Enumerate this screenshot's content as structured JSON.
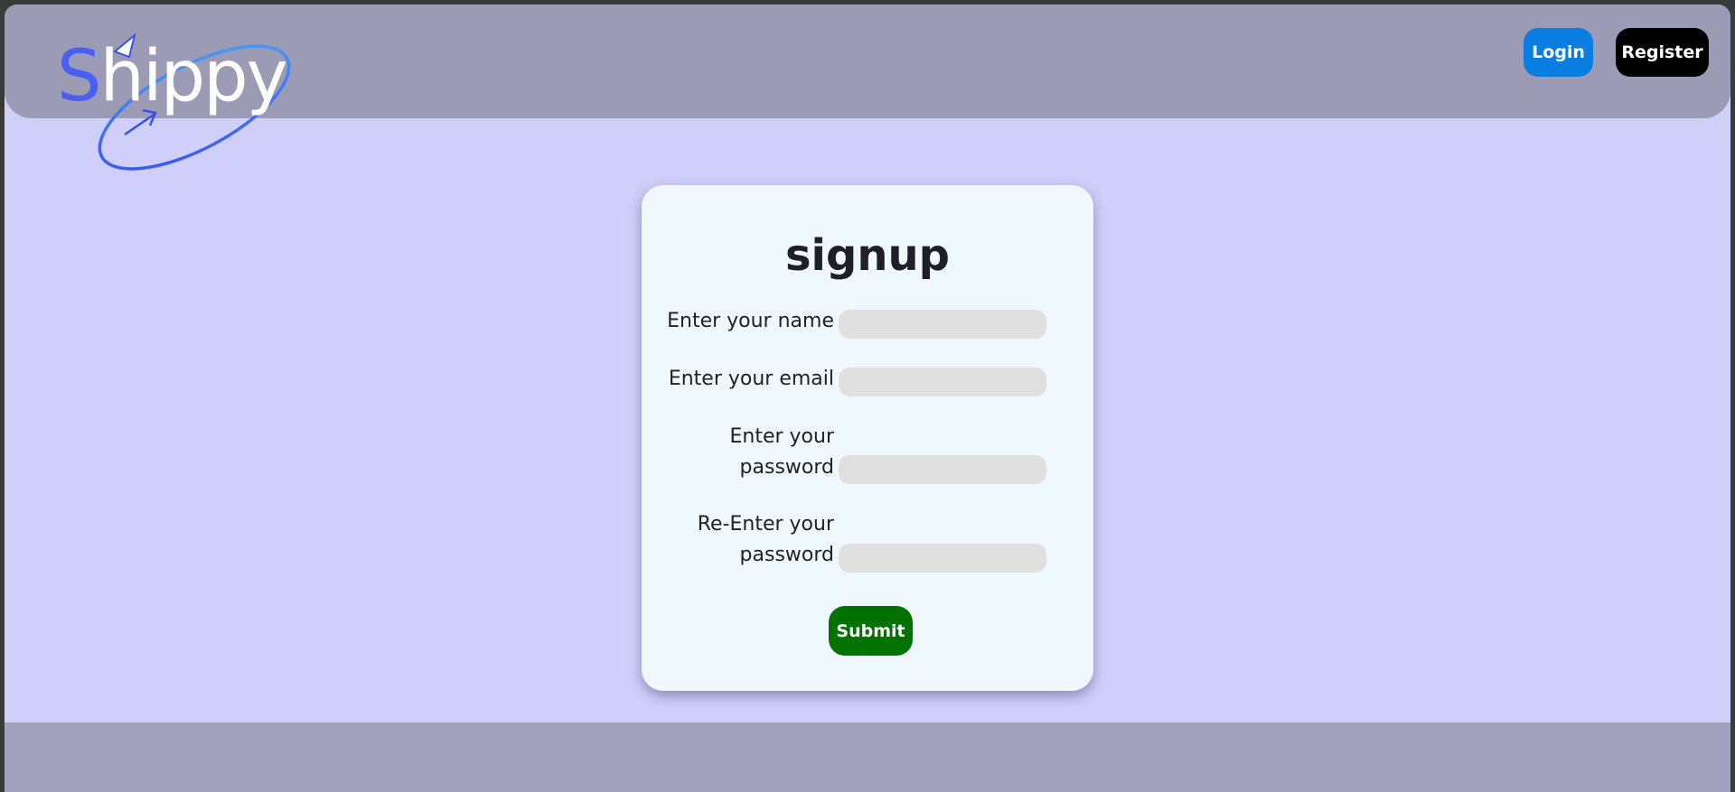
{
  "app": {
    "logo_text_first": "S",
    "logo_text_rest": "hippy",
    "colors": {
      "page_bg": "#d0cffa",
      "header_bg": "#9c9bb6",
      "footer_bg": "#a2a1bd",
      "card_bg": "#eef8fd",
      "logo_blue": "#4a5ef2",
      "login_btn": "#0a7ee0",
      "register_btn": "#000000",
      "submit_btn": "#007200",
      "input_bg": "#e0e0e0"
    }
  },
  "header": {
    "login_label": "Login",
    "register_label": "Register"
  },
  "form": {
    "title": "signup",
    "fields": [
      {
        "label_line1": "Enter your name",
        "label_line2": "",
        "value": "",
        "placeholder": ""
      },
      {
        "label_line1": "Enter your email",
        "label_line2": "",
        "value": "",
        "placeholder": ""
      },
      {
        "label_line1": "Enter your",
        "label_line2": "password",
        "value": "",
        "placeholder": ""
      },
      {
        "label_line1": "Re-Enter your",
        "label_line2": "password",
        "value": "",
        "placeholder": ""
      }
    ],
    "submit_label": "Submit"
  }
}
